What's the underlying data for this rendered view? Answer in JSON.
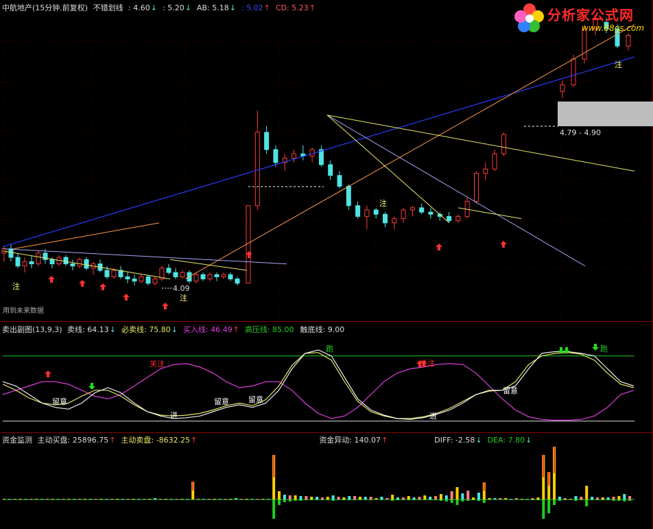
{
  "colors": {
    "up": "#ff3b3b",
    "down": "#4fe3e3",
    "blue": "#2a3bff",
    "orange": "#ff9a4a",
    "yellow": "#e8e868",
    "lilac": "#a8a8f8",
    "white": "#f0f0f0",
    "magenta": "#e040e0",
    "green": "#22cc22",
    "gray": "#c8c8c8",
    "border": "#8b0000"
  },
  "watermark": {
    "text": "分析家公式网",
    "url": "www.88gs.com",
    "icon": "flower-logo-icon"
  },
  "panel1": {
    "title": "中航地产(15分钟.前复权)",
    "indicator_name": "不错划线",
    "values": [
      {
        "label": "",
        "value": ": 4.60",
        "arrow": "↓",
        "color": "#dddddd",
        "arrow_color": "#4fe3e3"
      },
      {
        "label": "",
        "value": ": 5.20",
        "arrow": "↓",
        "color": "#dddddd",
        "arrow_color": "#4fe3e3"
      },
      {
        "label": "AB:",
        "value": "5.18",
        "arrow": "↓",
        "color": "#dddddd",
        "arrow_color": "#4fe3e3"
      },
      {
        "label": "",
        "value": ": 5.02",
        "arrow": "↑",
        "color": "#3b4bff",
        "arrow_color": "#ff3b3b"
      },
      {
        "label": "CD:",
        "value": "5.23",
        "arrow": "↑",
        "color": "#ff5a5a",
        "arrow_color": "#ff3b3b"
      }
    ],
    "footer_note": "用到未来数据",
    "price_labels": [
      "4.09",
      "4.79 - 4.90"
    ],
    "text_marks": [
      "注",
      "注",
      "注",
      "注"
    ]
  },
  "panel2": {
    "title": "卖出副图(13,9,3)",
    "values": [
      {
        "label": "卖线:",
        "value": "64.13",
        "arrow": "↓",
        "color": "#dddddd",
        "arrow_color": "#4fe3e3"
      },
      {
        "label": "必卖线:",
        "value": "75.80",
        "arrow": "↓",
        "color": "#e8e868",
        "arrow_color": "#4fe3e3"
      },
      {
        "label": "买入线:",
        "value": "46.49",
        "arrow": "↑",
        "color": "#e040e0",
        "arrow_color": "#ff3b3b"
      },
      {
        "label": "高压线:",
        "value": "85.00",
        "arrow": "",
        "color": "#22cc22",
        "arrow_color": "#22cc22"
      },
      {
        "label": "触底线:",
        "value": "9.00",
        "arrow": "",
        "color": "#dddddd",
        "arrow_color": "#dddddd"
      }
    ],
    "text_marks": [
      "留意",
      "留意",
      "留意",
      "留意",
      "进",
      "进",
      "跑",
      "跑",
      "关注",
      "关注"
    ]
  },
  "panel3": {
    "title": "资金监测",
    "values": [
      {
        "label": "主动买盘:",
        "value": "25896.75",
        "arrow": "↑",
        "color": "#dddddd",
        "arrow_color": "#ff3b3b"
      },
      {
        "label": "主动卖盘:",
        "value": "-8632.25",
        "arrow": "↑",
        "color": "#e8e868",
        "arrow_color": "#ff3b3b"
      },
      {
        "label": "资金异动:",
        "value": "140.07",
        "arrow": "↑",
        "color": "#dddddd",
        "arrow_color": "#ff3b3b"
      },
      {
        "label": "DIFF:",
        "value": "-2.58",
        "arrow": "↓",
        "color": "#dddddd",
        "arrow_color": "#4fe3e3"
      },
      {
        "label": "DEA:",
        "value": "7.80",
        "arrow": "↓",
        "color": "#22cc22",
        "arrow_color": "#4fe3e3"
      }
    ]
  },
  "chart_data": [
    {
      "type": "candlestick",
      "ylim": [
        3.95,
        5.35
      ],
      "candles": [
        [
          4.24,
          4.27,
          4.2,
          4.26
        ],
        [
          4.26,
          4.28,
          4.2,
          4.22
        ],
        [
          4.22,
          4.24,
          4.17,
          4.18
        ],
        [
          4.18,
          4.22,
          4.15,
          4.2
        ],
        [
          4.2,
          4.23,
          4.17,
          4.19
        ],
        [
          4.19,
          4.25,
          4.18,
          4.24
        ],
        [
          4.24,
          4.26,
          4.19,
          4.21
        ],
        [
          4.21,
          4.22,
          4.17,
          4.19
        ],
        [
          4.19,
          4.23,
          4.18,
          4.22
        ],
        [
          4.22,
          4.23,
          4.18,
          4.19
        ],
        [
          4.19,
          4.21,
          4.16,
          4.18
        ],
        [
          4.18,
          4.22,
          4.17,
          4.21
        ],
        [
          4.21,
          4.22,
          4.16,
          4.17
        ],
        [
          4.17,
          4.2,
          4.14,
          4.19
        ],
        [
          4.19,
          4.21,
          4.15,
          4.16
        ],
        [
          4.16,
          4.18,
          4.12,
          4.13
        ],
        [
          4.13,
          4.17,
          4.12,
          4.16
        ],
        [
          4.16,
          4.18,
          4.12,
          4.13
        ],
        [
          4.13,
          4.15,
          4.1,
          4.12
        ],
        [
          4.12,
          4.14,
          4.09,
          4.11
        ],
        [
          4.11,
          4.14,
          4.1,
          4.13
        ],
        [
          4.13,
          4.14,
          4.09,
          4.1
        ],
        [
          4.1,
          4.13,
          4.09,
          4.12
        ],
        [
          4.12,
          4.18,
          4.11,
          4.17
        ],
        [
          4.17,
          4.19,
          4.14,
          4.15
        ],
        [
          4.15,
          4.17,
          4.12,
          4.13
        ],
        [
          4.13,
          4.16,
          4.12,
          4.15
        ],
        [
          4.15,
          4.16,
          4.1,
          4.11
        ],
        [
          4.11,
          4.15,
          4.1,
          4.14
        ],
        [
          4.14,
          4.15,
          4.11,
          4.12
        ],
        [
          4.12,
          4.15,
          4.11,
          4.14
        ],
        [
          4.14,
          4.15,
          4.11,
          4.13
        ],
        [
          4.13,
          4.15,
          4.12,
          4.14
        ],
        [
          4.14,
          4.15,
          4.11,
          4.12
        ],
        [
          4.12,
          4.13,
          4.09,
          4.1
        ],
        [
          4.1,
          4.46,
          4.1,
          4.46
        ],
        [
          4.46,
          4.9,
          4.44,
          4.8
        ],
        [
          4.8,
          4.83,
          4.7,
          4.72
        ],
        [
          4.72,
          4.74,
          4.64,
          4.66
        ],
        [
          4.66,
          4.7,
          4.62,
          4.68
        ],
        [
          4.68,
          4.72,
          4.66,
          4.7
        ],
        [
          4.7,
          4.74,
          4.67,
          4.69
        ],
        [
          4.69,
          4.73,
          4.66,
          4.72
        ],
        [
          4.72,
          4.74,
          4.64,
          4.65
        ],
        [
          4.65,
          4.67,
          4.58,
          4.6
        ],
        [
          4.6,
          4.62,
          4.54,
          4.55
        ],
        [
          4.55,
          4.56,
          4.44,
          4.46
        ],
        [
          4.46,
          4.48,
          4.4,
          4.41
        ],
        [
          4.41,
          4.46,
          4.35,
          4.44
        ],
        [
          4.44,
          4.45,
          4.4,
          4.42
        ],
        [
          4.42,
          4.43,
          4.36,
          4.38
        ],
        [
          4.38,
          4.41,
          4.35,
          4.4
        ],
        [
          4.4,
          4.45,
          4.38,
          4.44
        ],
        [
          4.44,
          4.46,
          4.41,
          4.45
        ],
        [
          4.45,
          4.47,
          4.42,
          4.43
        ],
        [
          4.43,
          4.45,
          4.4,
          4.42
        ],
        [
          4.42,
          4.43,
          4.39,
          4.41
        ],
        [
          4.41,
          4.43,
          4.38,
          4.39
        ],
        [
          4.39,
          4.42,
          4.38,
          4.41
        ],
        [
          4.41,
          4.5,
          4.4,
          4.48
        ],
        [
          4.48,
          4.62,
          4.47,
          4.61
        ],
        [
          4.61,
          4.66,
          4.58,
          4.63
        ],
        [
          4.63,
          4.72,
          4.62,
          4.7
        ],
        [
          4.7,
          4.8,
          4.69,
          4.79
        ],
        [
          4.99,
          5.04,
          4.96,
          5.02
        ],
        [
          5.02,
          5.16,
          5.01,
          5.14
        ],
        [
          5.14,
          5.3,
          5.12,
          5.28
        ],
        [
          5.28,
          5.34,
          5.25,
          5.33
        ],
        [
          5.31,
          5.33,
          5.26,
          5.28
        ],
        [
          5.28,
          5.3,
          5.19,
          5.2
        ],
        [
          5.2,
          5.26,
          5.18,
          5.25
        ]
      ],
      "yellow_line": [
        [
          0,
          4.26
        ],
        [
          42,
          4.12
        ],
        [
          45,
          4.11
        ]
      ],
      "white_line": [
        [
          0,
          4.26
        ],
        [
          70,
          4.2
        ]
      ],
      "yellow_line2": [
        [
          48,
          4.88
        ],
        [
          120,
          4.6
        ]
      ],
      "lilac_line": [
        [
          48,
          4.88
        ],
        [
          102,
          4.35
        ]
      ],
      "yellow_line3": [
        [
          48,
          4.88
        ],
        [
          82,
          4.44
        ]
      ],
      "orange_short": [
        [
          5,
          4.26
        ],
        [
          29,
          4.38
        ]
      ],
      "orange_long": [
        [
          30,
          4.12
        ],
        [
          114,
          5.28
        ]
      ],
      "blue_line": [
        [
          0,
          4.27
        ],
        [
          114,
          5.15
        ]
      ],
      "gray_box": {
        "y_top": 5.0,
        "y_bottom": 4.9
      },
      "dashed": [
        {
          "x0": 36,
          "x1": 48,
          "y": 4.7
        },
        {
          "x0": 77,
          "x1": 82,
          "y": 4.8
        }
      ]
    },
    {
      "type": "line",
      "ylim": [
        0,
        100
      ],
      "reference_lines": [
        85,
        9
      ],
      "sell_line": [
        55,
        50,
        40,
        30,
        25,
        23,
        30,
        42,
        48,
        42,
        30,
        20,
        15,
        12,
        13,
        15,
        20,
        25,
        28,
        25,
        30,
        45,
        70,
        88,
        92,
        85,
        60,
        35,
        22,
        16,
        12,
        11,
        13,
        17,
        22,
        30,
        40,
        45,
        45,
        50,
        70,
        88,
        90,
        90,
        88,
        85,
        70,
        55,
        50
      ],
      "must_sell_line": [
        52,
        45,
        36,
        30,
        28,
        30,
        38,
        45,
        45,
        38,
        28,
        20,
        16,
        15,
        16,
        18,
        22,
        27,
        30,
        27,
        34,
        50,
        74,
        88,
        89,
        80,
        55,
        32,
        20,
        15,
        12,
        12,
        14,
        18,
        24,
        32,
        40,
        44,
        45,
        55,
        75,
        85,
        88,
        89,
        87,
        80,
        65,
        52,
        48
      ],
      "buy_line": [
        40,
        45,
        50,
        55,
        55,
        52,
        45,
        38,
        35,
        40,
        50,
        60,
        70,
        75,
        76,
        72,
        65,
        55,
        48,
        50,
        55,
        55,
        45,
        30,
        18,
        12,
        15,
        25,
        40,
        55,
        65,
        70,
        72,
        75,
        76,
        75,
        65,
        50,
        35,
        22,
        14,
        11,
        10,
        10,
        11,
        15,
        25,
        40,
        45
      ]
    },
    {
      "type": "bar",
      "ylim": [
        -40,
        80
      ],
      "series_up": [
        1,
        1,
        1,
        1,
        1,
        1,
        1,
        1,
        1,
        1,
        1,
        1,
        1,
        1,
        1,
        1,
        1,
        1,
        1,
        1,
        1,
        1,
        1,
        1,
        1,
        1,
        1,
        1,
        2,
        1,
        1,
        1,
        1,
        1,
        1,
        26,
        1,
        1,
        1,
        1,
        1,
        1,
        1,
        2,
        1,
        1,
        1,
        1,
        1,
        1,
        65,
        12,
        7,
        6,
        6,
        5,
        5,
        4,
        4,
        3,
        4,
        6,
        4,
        3,
        5,
        5,
        4,
        4,
        4,
        2,
        4,
        2,
        7,
        3,
        3,
        5,
        3,
        4,
        6,
        4,
        5,
        8,
        6,
        12,
        18,
        9,
        13,
        3,
        10,
        25,
        2,
        2,
        2,
        2,
        1,
        2,
        1,
        1,
        2,
        3,
        65,
        40,
        77,
        4,
        2,
        1,
        5,
        4,
        20,
        4,
        3,
        3,
        3,
        4,
        5,
        8,
        5
      ],
      "series_down": [
        0,
        0,
        0,
        0,
        0,
        0,
        0,
        0,
        0,
        0,
        0,
        0,
        0,
        0,
        0,
        0,
        0,
        0,
        0,
        0,
        0,
        0,
        0,
        0,
        0,
        0,
        0,
        0,
        0,
        0,
        0,
        0,
        0,
        0,
        0,
        0,
        0,
        0,
        0,
        0,
        0,
        0,
        0,
        0,
        0,
        0,
        0,
        0,
        0,
        0,
        28,
        8,
        4,
        3,
        2,
        2,
        1,
        1,
        1,
        1,
        1,
        2,
        1,
        1,
        1,
        1,
        1,
        1,
        1,
        0,
        1,
        0,
        2,
        1,
        1,
        1,
        1,
        1,
        1,
        1,
        1,
        2,
        3,
        5,
        8,
        3,
        2,
        1,
        2,
        5,
        0,
        0,
        0,
        0,
        0,
        0,
        0,
        0,
        1,
        1,
        28,
        20,
        8,
        2,
        1,
        0,
        2,
        1,
        10,
        1,
        1,
        1,
        1,
        2,
        2,
        3,
        2
      ]
    }
  ]
}
